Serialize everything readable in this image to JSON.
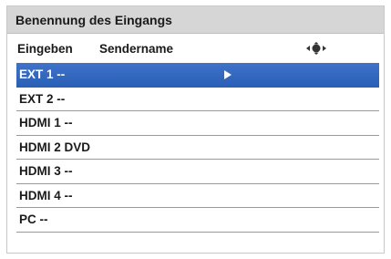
{
  "title": "Benennung des Eingangs",
  "header": {
    "col1": "Eingeben",
    "col2": "Sendername",
    "nav_icon": "navigation-pad-icon"
  },
  "selected_index": 0,
  "colors": {
    "highlight": "#2f65be",
    "titlebar": "#d6d6d6"
  },
  "inputs": [
    {
      "label": "EXT 1 --"
    },
    {
      "label": "EXT 2 --"
    },
    {
      "label": "HDMI 1 --"
    },
    {
      "label": "HDMI 2 DVD"
    },
    {
      "label": "HDMI 3 --"
    },
    {
      "label": "HDMI 4 --"
    },
    {
      "label": "PC --"
    }
  ]
}
